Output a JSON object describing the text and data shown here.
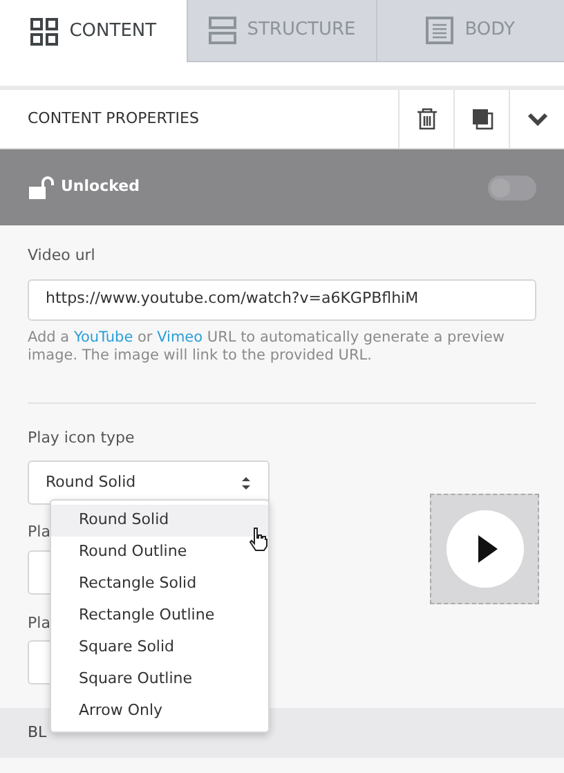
{
  "tabs": [
    {
      "label": "CONTENT",
      "selected": true
    },
    {
      "label": "STRUCTURE",
      "selected": false
    },
    {
      "label": "BODY",
      "selected": false
    }
  ],
  "panel": {
    "title": "CONTENT PROPERTIES"
  },
  "lock": {
    "label": "Unlocked",
    "locked": false,
    "on": false
  },
  "video_url": {
    "label": "Video url",
    "value": "https://www.youtube.com/watch?v=a6KGPBflhiM",
    "help": [
      {
        "kind": "text",
        "text": "Add a "
      },
      {
        "kind": "link",
        "text": "YouTube"
      },
      {
        "kind": "text",
        "text": " or "
      },
      {
        "kind": "link",
        "text": "Vimeo"
      },
      {
        "kind": "text",
        "text": " URL to automatically generate a preview image. The image will link to the provided URL."
      }
    ]
  },
  "play_icon_type": {
    "label": "Play icon type",
    "value": "Round Solid",
    "expanded": true,
    "options": [
      {
        "label": "Round Solid",
        "selected": true
      },
      {
        "label": "Round Outline",
        "selected": false
      },
      {
        "label": "Rectangle Solid",
        "selected": false
      },
      {
        "label": "Rectangle Outline",
        "selected": false
      },
      {
        "label": "Square Solid",
        "selected": false
      },
      {
        "label": "Square Outline",
        "selected": false
      },
      {
        "label": "Arrow Only",
        "selected": false
      }
    ]
  },
  "covered_fields": [
    {
      "label": "Pla"
    },
    {
      "label": "Pla"
    }
  ],
  "section": {
    "title": "BL"
  }
}
